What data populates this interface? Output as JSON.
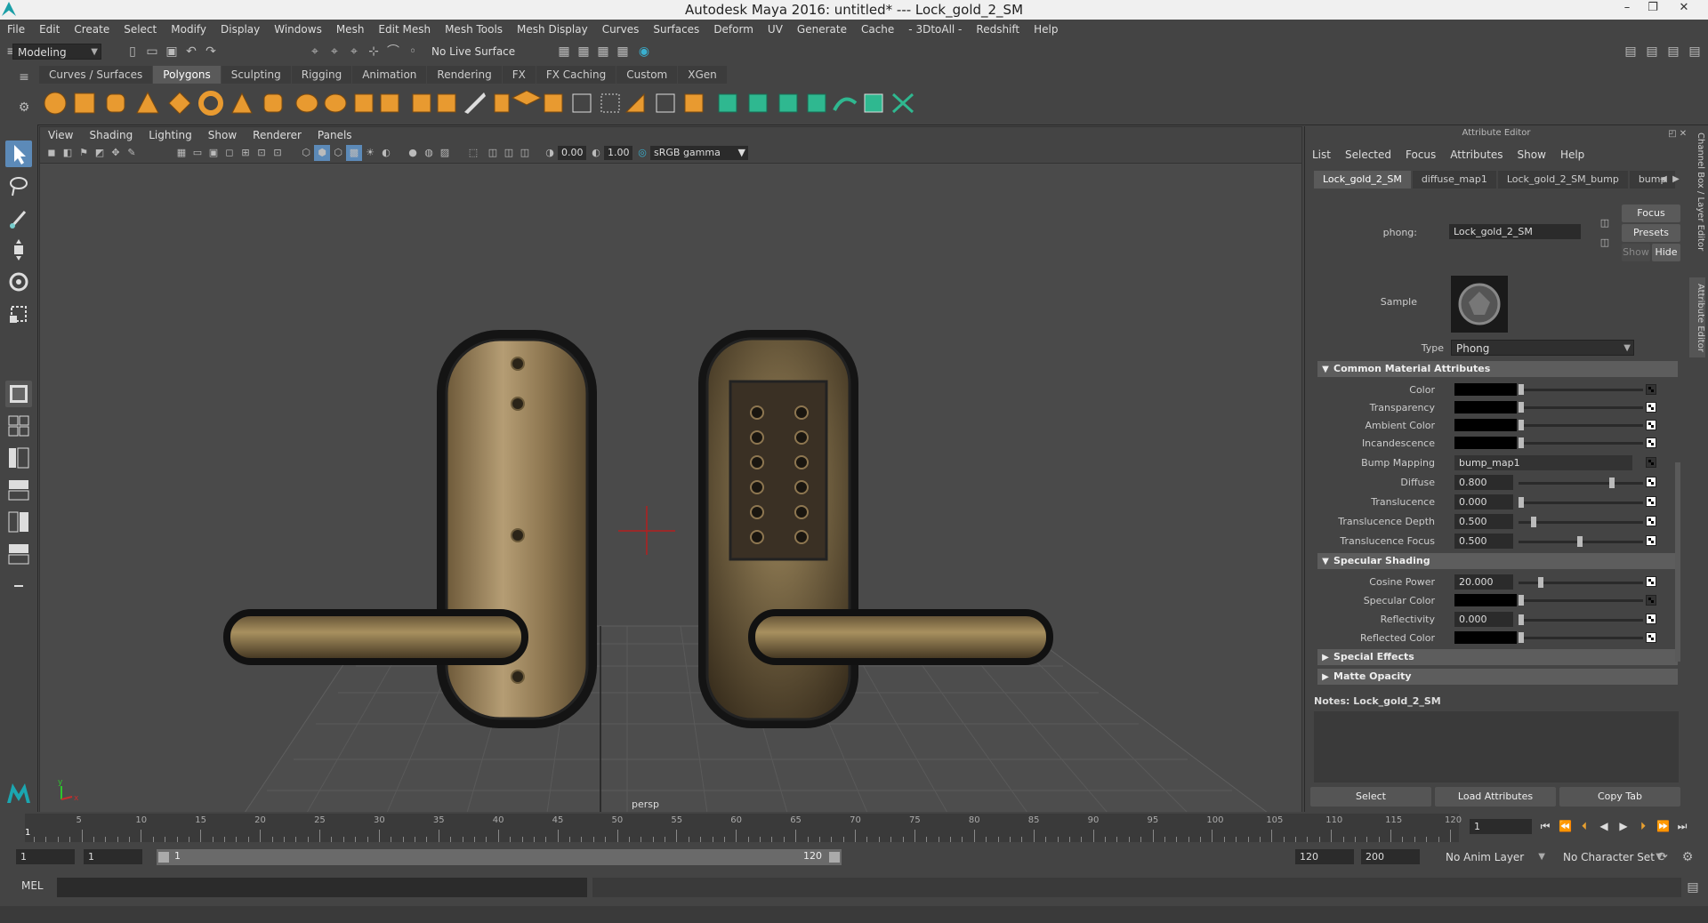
{
  "window": {
    "title": "Autodesk Maya 2016: untitled*   ---   Lock_gold_2_SM",
    "minimize": "–",
    "restore": "❐",
    "close": "✕"
  },
  "menubar": [
    "File",
    "Edit",
    "Create",
    "Select",
    "Modify",
    "Display",
    "Windows",
    "Mesh",
    "Edit Mesh",
    "Mesh Tools",
    "Mesh Display",
    "Curves",
    "Surfaces",
    "Deform",
    "UV",
    "Generate",
    "Cache",
    "- 3DtoAll -",
    "Redshift",
    "Help"
  ],
  "statusline": {
    "mode": "Modeling",
    "live_surface": "No Live Surface"
  },
  "shelf": {
    "tabs": [
      "Curves / Surfaces",
      "Polygons",
      "Sculpting",
      "Rigging",
      "Animation",
      "Rendering",
      "FX",
      "FX Caching",
      "Custom",
      "XGen"
    ],
    "active_tab": "Polygons",
    "accent_color": "#f0a030",
    "teal_color": "#2fb890"
  },
  "viewport": {
    "menu": [
      "View",
      "Shading",
      "Lighting",
      "Show",
      "Renderer",
      "Panels"
    ],
    "exposure": "0.00",
    "gamma": "1.00",
    "color_space": "sRGB gamma",
    "camera_label": "persp",
    "axis_y": "y",
    "axis_x": "x"
  },
  "attribute_editor": {
    "header": "Attribute Editor",
    "menu": [
      "List",
      "Selected",
      "Focus",
      "Attributes",
      "Show",
      "Help"
    ],
    "tabs": [
      "Lock_gold_2_SM",
      "diffuse_map1",
      "Lock_gold_2_SM_bump",
      "bump"
    ],
    "active_tab": "Lock_gold_2_SM",
    "node_type_label": "phong:",
    "node_name": "Lock_gold_2_SM",
    "buttons": {
      "focus": "Focus",
      "presets": "Presets",
      "show": "Show",
      "hide": "Hide"
    },
    "sample_label": "Sample",
    "type_label": "Type",
    "type_value": "Phong",
    "common_section": "Common Material Attributes",
    "attrs": {
      "color": "Color",
      "transparency": "Transparency",
      "ambient_color": "Ambient Color",
      "incandescence": "Incandescence",
      "bump_mapping": "Bump Mapping",
      "bump_mapping_value": "bump_map1",
      "diffuse": "Diffuse",
      "diffuse_value": "0.800",
      "translucence": "Translucence",
      "translucence_value": "0.000",
      "translucence_depth": "Translucence Depth",
      "translucence_depth_value": "0.500",
      "translucence_focus": "Translucence Focus",
      "translucence_focus_value": "0.500"
    },
    "specular_section": "Specular Shading",
    "specular": {
      "cosine_power": "Cosine Power",
      "cosine_power_value": "20.000",
      "specular_color": "Specular Color",
      "reflectivity": "Reflectivity",
      "reflectivity_value": "0.000",
      "reflected_color": "Reflected Color"
    },
    "special_effects": "Special Effects",
    "matte_opacity": "Matte Opacity",
    "notes": "Notes:  Lock_gold_2_SM",
    "bottom_buttons": [
      "Select",
      "Load Attributes",
      "Copy Tab"
    ]
  },
  "side_tabs": [
    "Channel Box / Layer Editor",
    "Attribute Editor"
  ],
  "timeline": {
    "ticks": [
      "5",
      "10",
      "15",
      "20",
      "25",
      "30",
      "35",
      "40",
      "45",
      "50",
      "55",
      "60",
      "65",
      "70",
      "75",
      "80",
      "85",
      "90",
      "95",
      "100",
      "105",
      "110",
      "115",
      "120"
    ],
    "start_marker": "1",
    "current_frame": "1"
  },
  "range": {
    "start": "1",
    "playback_start": "1",
    "range_start_label": "1",
    "range_end_label": "120",
    "playback_end": "120",
    "end": "200",
    "anim_layer": "No Anim Layer",
    "character_set": "No Character Set"
  },
  "command": {
    "language": "MEL"
  }
}
